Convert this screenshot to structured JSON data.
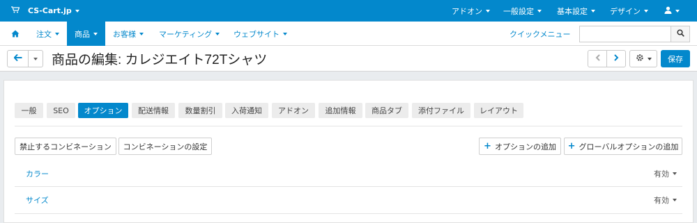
{
  "topbar": {
    "brand": "CS-Cart.jp",
    "cart_icon": "cart-icon",
    "menus": [
      {
        "label": "アドオン"
      },
      {
        "label": "一般設定"
      },
      {
        "label": "基本設定"
      },
      {
        "label": "デザイン"
      }
    ],
    "user_icon": "user-icon"
  },
  "nav": {
    "home_icon": "home-icon",
    "items": [
      {
        "label": "注文"
      },
      {
        "label": "商品"
      },
      {
        "label": "お客様"
      },
      {
        "label": "マーケティング"
      },
      {
        "label": "ウェブサイト"
      }
    ],
    "quick_menu": "クイックメニュー",
    "search": {
      "placeholder": "",
      "value": ""
    }
  },
  "title": {
    "text": "商品の編集: カレジエイト72Tシャツ",
    "save_label": "保存"
  },
  "tabs": [
    {
      "label": "一般"
    },
    {
      "label": "SEO"
    },
    {
      "label": "オプション"
    },
    {
      "label": "配送情報"
    },
    {
      "label": "数量割引"
    },
    {
      "label": "入荷通知"
    },
    {
      "label": "アドオン"
    },
    {
      "label": "追加情報"
    },
    {
      "label": "商品タブ"
    },
    {
      "label": "添付ファイル"
    },
    {
      "label": "レイアウト"
    }
  ],
  "actions": {
    "forbidden_combinations": "禁止するコンビネーション",
    "combination_settings": "コンビネーションの設定",
    "add_option": "オプションの追加",
    "add_global_option": "グローバルオプションの追加"
  },
  "options": [
    {
      "name": "カラー",
      "status": "有効"
    },
    {
      "name": "サイズ",
      "status": "有効"
    }
  ],
  "colors": {
    "accent": "#0388cc"
  }
}
